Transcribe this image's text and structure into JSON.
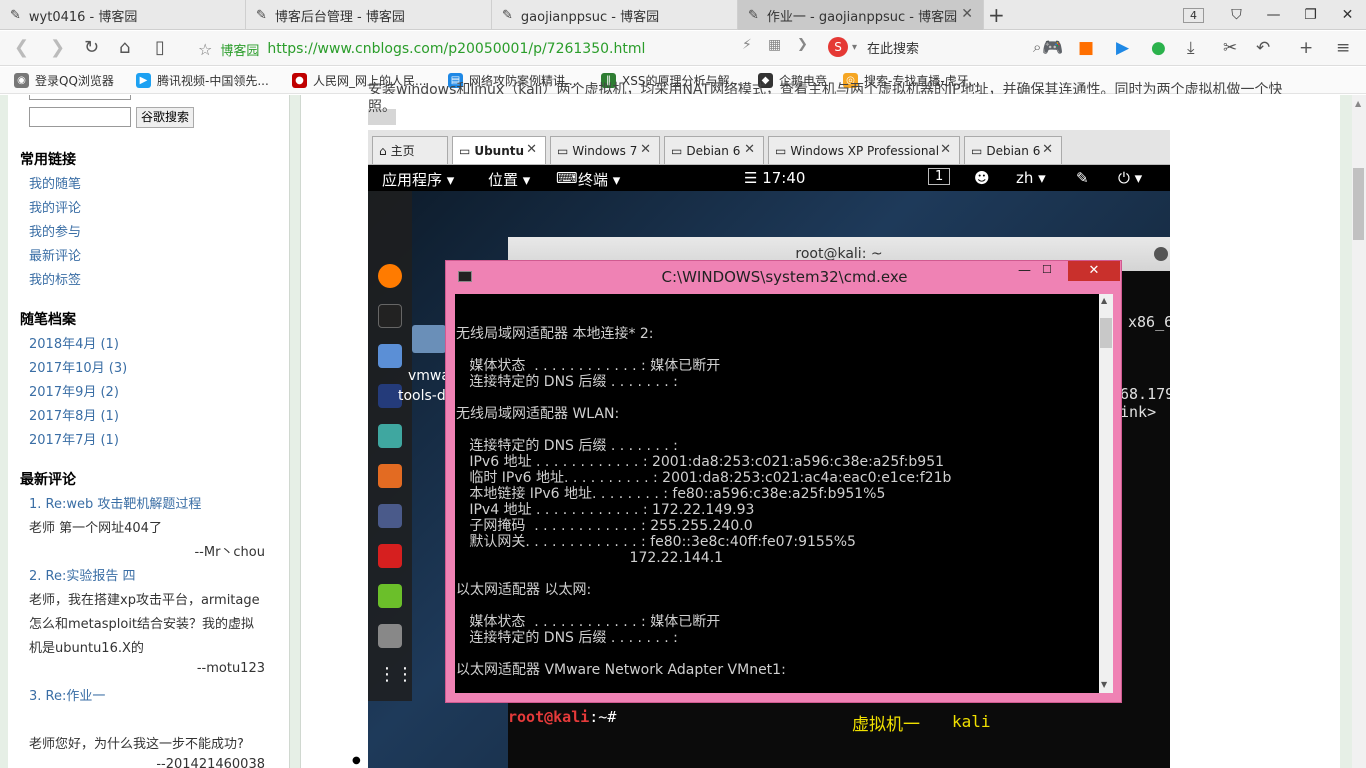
{
  "browser": {
    "tabs": [
      {
        "label": "wyt0416 - 博客园",
        "active": false
      },
      {
        "label": "博客后台管理 - 博客园",
        "active": false
      },
      {
        "label": "gaojianppsuc - 博客园",
        "active": false
      },
      {
        "label": "作业一 - gaojianppsuc - 博客园",
        "active": true
      }
    ],
    "tab_count": "4",
    "address": {
      "site_name": "博客园",
      "url": "https://www.cnblogs.com/p20050001/p/7261350.html",
      "search_label": "在此搜索"
    },
    "bookmarks": [
      {
        "label": "登录QQ浏览器",
        "color": "#777777"
      },
      {
        "label": "腾讯视频-中国领先...",
        "color": "#1da1f2"
      },
      {
        "label": "人民网_网上的人民...",
        "color": "#c00000"
      },
      {
        "label": "网络攻防案例精讲...",
        "color": "#1e88e5"
      },
      {
        "label": "XSS的原理分析与解...",
        "color": "#2e7d32"
      },
      {
        "label": "企鹅电竞",
        "color": "#333333"
      },
      {
        "label": "搜索-专找直播-虎牙...",
        "color": "#f5a623"
      }
    ]
  },
  "sidebar": {
    "search_button": "谷歌搜索",
    "common_links_title": "常用链接",
    "common_links": [
      "我的随笔",
      "我的评论",
      "我的参与",
      "最新评论",
      "我的标签"
    ],
    "archive_title": "随笔档案",
    "archive": [
      "2018年4月 (1)",
      "2017年10月 (3)",
      "2017年9月 (2)",
      "2017年8月 (1)",
      "2017年7月 (1)"
    ],
    "recent_title": "最新评论",
    "comments": [
      {
        "title": "1. Re:web 攻击靶机解题过程",
        "body": [
          "老师 第一个网址404了"
        ],
        "author": "--Mr丶chou"
      },
      {
        "title": "2. Re:实验报告 四",
        "body": [
          "老师，我在搭建xp攻击平台，armitage",
          "怎么和metasploit结合安装？我的虚拟",
          "机是ubuntu16.X的"
        ],
        "author": "--motu123"
      },
      {
        "title": "3. Re:作业一",
        "body": [
          "老师您好，为什么我这一步不能成功?"
        ],
        "author": "--201421460038"
      }
    ]
  },
  "content": {
    "top_line": "安装windows和linux（kali）两个虚拟机，均采用NAT网络模式，查看主机与两个虚拟机器的IP地址，并确保其连通性。同时为两个虚拟机做一个快",
    "top_line_end": "照。"
  },
  "vm": {
    "tabs": [
      "主页",
      "Ubuntu",
      "Windows 7",
      "Debian 6",
      "Windows XP Professional",
      "Debian 6"
    ],
    "kali_bar": {
      "apps": "应用程序 ▾",
      "places": "位置 ▾",
      "terminal": "终端 ▾",
      "clock": "☰ 17:40",
      "workspace": "1",
      "lang": "zh ▾"
    },
    "terminal_title": "root@kali: ~",
    "terminal_fragments": [
      "x86_6",
      "68.179",
      "ink>"
    ],
    "desktop_labels": [
      "vmwa",
      "tools-d"
    ],
    "prompt_user": "root@kali",
    "prompt_rest": ":~#",
    "caption_cn": "虚拟机一",
    "caption_en": "kali"
  },
  "cmd": {
    "title": "C:\\WINDOWS\\system32\\cmd.exe",
    "lines": [
      "",
      "无线局域网适配器 本地连接* 2:",
      "",
      "   媒体状态  . . . . . . . . . . . . : 媒体已断开",
      "   连接特定的 DNS 后缀 . . . . . . . :",
      "",
      "无线局域网适配器 WLAN:",
      "",
      "   连接特定的 DNS 后缀 . . . . . . . :",
      "   IPv6 地址 . . . . . . . . . . . . : 2001:da8:253:c021:a596:c38e:a25f:b951",
      "   临时 IPv6 地址. . . . . . . . . . : 2001:da8:253:c021:ac4a:eac0:e1ce:f21b",
      "   本地链接 IPv6 地址. . . . . . . . : fe80::a596:c38e:a25f:b951%5",
      "   IPv4 地址 . . . . . . . . . . . . : 172.22.149.93",
      "   子网掩码  . . . . . . . . . . . . : 255.255.240.0",
      "   默认网关. . . . . . . . . . . . . : fe80::3e8c:40ff:fe07:9155%5",
      "                                       172.22.144.1",
      "",
      "以太网适配器 以太网:",
      "",
      "   媒体状态  . . . . . . . . . . . . : 媒体已断开",
      "   连接特定的 DNS 后缀 . . . . . . . :",
      "",
      "以太网适配器 VMware Network Adapter VMnet1:"
    ]
  }
}
